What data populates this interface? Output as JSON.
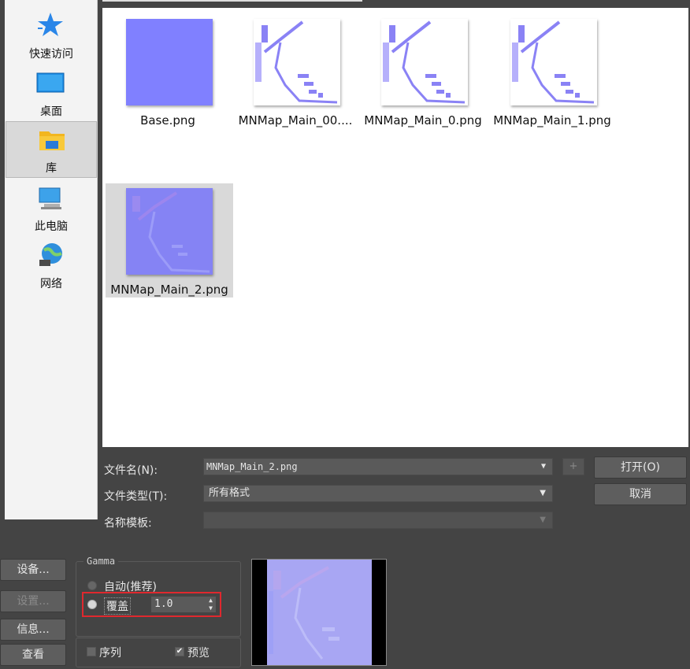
{
  "sidebar": {
    "items": [
      {
        "label": "快速访问",
        "icon": "star-icon"
      },
      {
        "label": "桌面",
        "icon": "desktop-icon"
      },
      {
        "label": "库",
        "icon": "library-folder-icon",
        "selected": true
      },
      {
        "label": "此电脑",
        "icon": "computer-icon"
      },
      {
        "label": "网络",
        "icon": "network-globe-icon"
      }
    ]
  },
  "files": [
    {
      "name": "Base.png",
      "type": "flat-normal"
    },
    {
      "name": "MNMap_Main_00....",
      "type": "line-map"
    },
    {
      "name": "MNMap_Main_0.png",
      "type": "line-map"
    },
    {
      "name": "MNMap_Main_1.png",
      "type": "line-map"
    },
    {
      "name": "MNMap_Main_2.png",
      "type": "normal-map",
      "selected": true
    }
  ],
  "form": {
    "filename_label": "文件名(N):",
    "filename_value": "MNMap_Main_2.png",
    "filetype_label": "文件类型(T):",
    "filetype_value": "所有格式",
    "template_label": "名称模板:",
    "template_value": "",
    "add_label": "+",
    "open_label": "打开(O)",
    "cancel_label": "取消"
  },
  "left_buttons": {
    "devices": "设备...",
    "setup": "设置...",
    "info": "信息...",
    "view": "查看"
  },
  "gamma": {
    "title": "Gamma",
    "auto_label": "自动(推荐)",
    "override_label": "覆盖",
    "override_value": "1.0",
    "selected": "override"
  },
  "options": {
    "sequence_label": "序列",
    "sequence_checked": false,
    "preview_label": "预览",
    "preview_checked": true
  },
  "colors": {
    "accent_highlight": "#e0282e",
    "normal_map": "#8080ff"
  }
}
